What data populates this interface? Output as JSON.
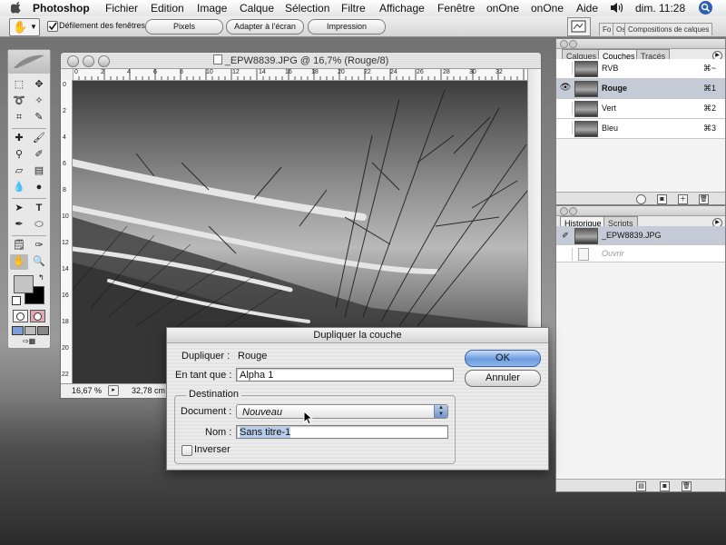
{
  "menubar": {
    "app": "Photoshop",
    "items": [
      "Fichier",
      "Edition",
      "Image",
      "Calque",
      "Sélection",
      "Filtre",
      "Affichage",
      "Fenêtre",
      "onOne",
      "onOne",
      "Aide"
    ],
    "clock": "dim. 11:28"
  },
  "options": {
    "scroll_all_label": "Défilement des fenêtres",
    "scroll_all_checked": true,
    "btn_pixels": "Pixels",
    "btn_fit": "Adapter à l'écran",
    "btn_print": "Impression",
    "well_tabs": [
      "Fo",
      "Os",
      "Compositions de calques"
    ]
  },
  "document": {
    "title": "_EPW8839.JPG @ 16,7% (Rouge/8)",
    "zoom": "16,67 %",
    "size_info": "32,78 cm x",
    "ruler_h": [
      "0",
      "2",
      "4",
      "6",
      "8",
      "10",
      "12",
      "14",
      "16",
      "18",
      "20",
      "22",
      "24",
      "26",
      "28",
      "30",
      "32"
    ],
    "ruler_v": [
      "0",
      "2",
      "4",
      "6",
      "8",
      "10",
      "12",
      "14",
      "16",
      "18",
      "20",
      "22"
    ]
  },
  "layers_palette": {
    "tabs": [
      "Calques",
      "Couches",
      "Tracés"
    ],
    "active_tab": "Couches",
    "channels": [
      {
        "name": "RVB",
        "shortcut": "⌘~",
        "visible": false,
        "selected": false
      },
      {
        "name": "Rouge",
        "shortcut": "⌘1",
        "visible": true,
        "selected": true
      },
      {
        "name": "Vert",
        "shortcut": "⌘2",
        "visible": false,
        "selected": false
      },
      {
        "name": "Bleu",
        "shortcut": "⌘3",
        "visible": false,
        "selected": false
      }
    ]
  },
  "history_palette": {
    "tabs": [
      "Historique",
      "Scripts"
    ],
    "active_tab": "Historique",
    "snapshot": "_EPW8839.JPG",
    "state": "Ouvrir"
  },
  "dialog": {
    "title": "Dupliquer la couche",
    "duplicate_label": "Dupliquer :",
    "duplicate_value": "Rouge",
    "as_label": "En tant que :",
    "as_value": "Alpha 1",
    "destination_label": "Destination",
    "document_label": "Document :",
    "document_value": "Nouveau",
    "name_label": "Nom :",
    "name_value": "Sans titre-1",
    "invert_label": "Inverser",
    "invert_checked": false,
    "ok": "OK",
    "cancel": "Annuler"
  }
}
